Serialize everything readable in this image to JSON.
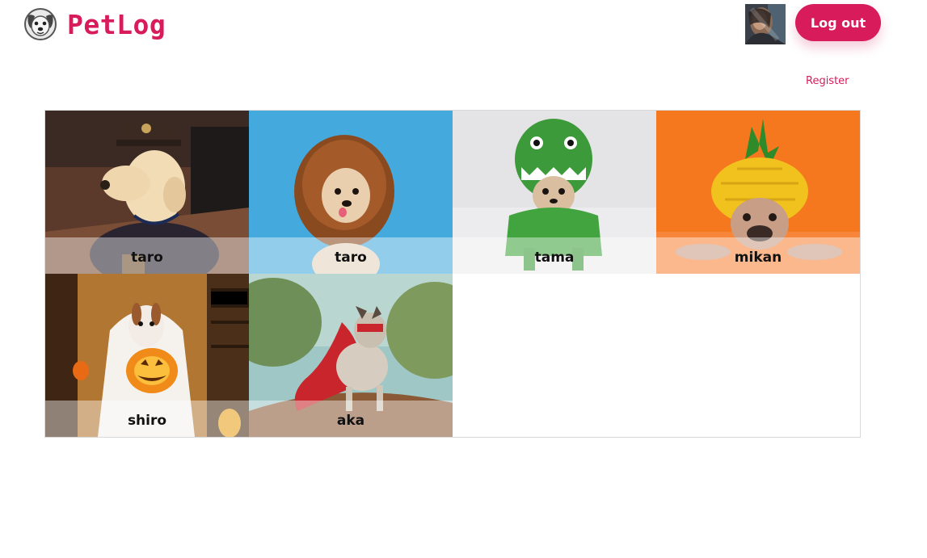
{
  "header": {
    "brand_name": "PetLog",
    "logout_label": "Log out",
    "register_label": "Register"
  },
  "colors": {
    "accent": "#d81b5a",
    "selected_outline": "#e0567d"
  },
  "icons": {
    "brand": "dog-face-icon"
  },
  "pets": [
    {
      "name": "taro",
      "photo": "dog in ups delivery costume",
      "selected": false
    },
    {
      "name": "taro",
      "photo": "chihuahua in lion mane costume",
      "selected": false
    },
    {
      "name": "tama",
      "photo": "chihuahua in green dinosaur costume",
      "selected": false
    },
    {
      "name": "mikan",
      "photo": "french bulldog in pineapple costume",
      "selected": false
    },
    {
      "name": "shiro",
      "photo": "dog in ghost costume with pumpkin",
      "selected": true
    },
    {
      "name": "aka",
      "photo": "french bulldog in red superhero cape and mask",
      "selected": false
    }
  ]
}
